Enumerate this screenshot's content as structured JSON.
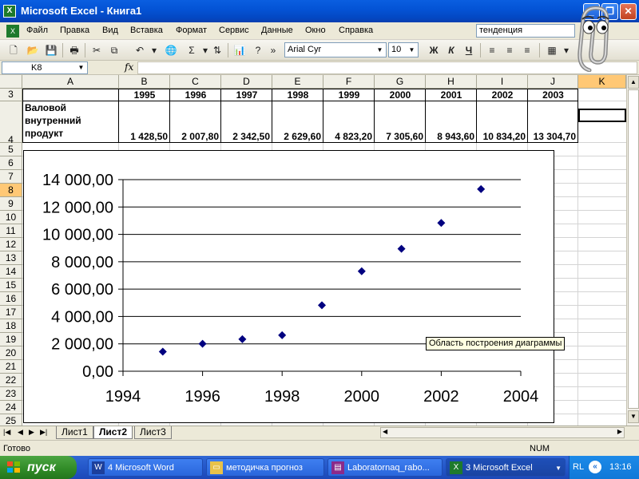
{
  "window": {
    "title": "Microsoft Excel - Книга1",
    "buttons": {
      "minimize": "_",
      "restore": "❐",
      "close": "✕"
    }
  },
  "menubar": {
    "items": [
      "Файл",
      "Правка",
      "Вид",
      "Вставка",
      "Формат",
      "Сервис",
      "Данные",
      "Окно",
      "Справка"
    ],
    "ask_box": "тенденция"
  },
  "toolbar": {
    "font": "Arial Cyr",
    "font_size": "10",
    "bold": "Ж",
    "italic": "К",
    "underline": "Ч"
  },
  "formula_bar": {
    "name_box": "K8",
    "fx_label": "fx",
    "value": ""
  },
  "grid": {
    "columns": [
      "A",
      "B",
      "C",
      "D",
      "E",
      "F",
      "G",
      "H",
      "I",
      "J",
      "K"
    ],
    "rows": [
      "3",
      "4",
      "5",
      "6",
      "7",
      "8",
      "9",
      "10",
      "11",
      "12",
      "13",
      "14",
      "15",
      "16",
      "17",
      "18",
      "19",
      "20",
      "21",
      "22",
      "23",
      "24",
      "25"
    ],
    "selected_column": "K",
    "selected_row": "8",
    "years": [
      "1995",
      "1996",
      "1997",
      "1998",
      "1999",
      "2000",
      "2001",
      "2002",
      "2003"
    ],
    "label_lines": [
      "Валовой",
      "внутренний",
      "продукт"
    ],
    "values": [
      "1 428,50",
      "2 007,80",
      "2 342,50",
      "2 629,60",
      "4 823,20",
      "7 305,60",
      "8 943,60",
      "10 834,20",
      "13 304,70"
    ]
  },
  "chart_data": {
    "type": "scatter",
    "x": [
      1995,
      1996,
      1997,
      1998,
      1999,
      2000,
      2001,
      2002,
      2003
    ],
    "y": [
      1428.5,
      2007.8,
      2342.5,
      2629.6,
      4823.2,
      7305.6,
      8943.6,
      10834.2,
      13304.7
    ],
    "xlim": [
      1994,
      2004
    ],
    "ylim": [
      0,
      14000
    ],
    "x_ticks": [
      "1994",
      "1996",
      "1998",
      "2000",
      "2002",
      "2004"
    ],
    "y_ticks": [
      "0,00",
      "2 000,00",
      "4 000,00",
      "6 000,00",
      "8 000,00",
      "10 000,00",
      "12 000,00",
      "14 000,00"
    ],
    "grid": "horizontal",
    "marker": "diamond",
    "marker_color": "#000080",
    "title": "",
    "xlabel": "",
    "ylabel": ""
  },
  "tooltip": "Область построения диаграммы",
  "sheets": {
    "tabs": [
      "Лист1",
      "Лист2",
      "Лист3"
    ],
    "active": "Лист2"
  },
  "statusbar": {
    "ready": "Готово",
    "num": "NUM"
  },
  "taskbar": {
    "start": "пуск",
    "tasks": [
      "4 Microsoft Word",
      "методичка прогноз",
      "Laboratornaq_rabo...",
      "3 Microsoft Excel"
    ],
    "lang": "RL",
    "time": "13:16"
  }
}
